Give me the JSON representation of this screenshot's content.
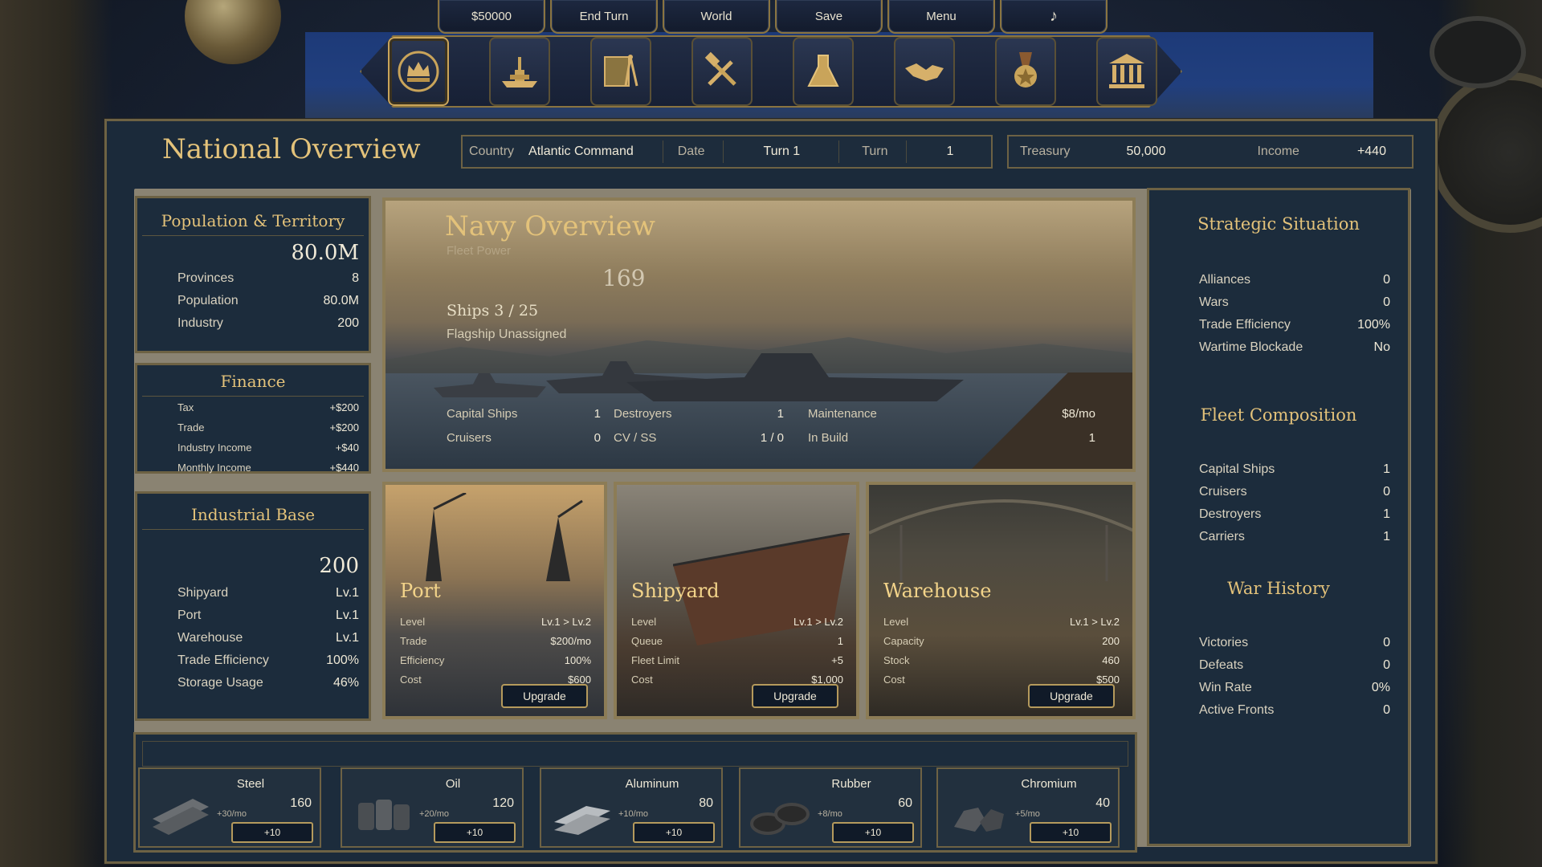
{
  "topbar": {
    "buttons": [
      "$50000",
      "End Turn",
      "World",
      "Save",
      "Menu",
      "♪"
    ]
  },
  "nav_icons": [
    "crown-icon",
    "battleship-icon",
    "map-compass-icon",
    "hammer-wrench-icon",
    "flask-icon",
    "handshake-icon",
    "medal-icon",
    "government-building-icon"
  ],
  "header": {
    "title": "National Overview",
    "country_label": "Country",
    "country": "Atlantic Command",
    "date_label": "Date",
    "date": "Turn 1",
    "turn_label": "Turn",
    "turn": "1",
    "treasury_label": "Treasury",
    "treasury": "50,000",
    "income_label": "Income",
    "income": "+440"
  },
  "population": {
    "title": "Population & Territory",
    "big": "80.0M",
    "rows": [
      {
        "label": "Provinces",
        "value": "8"
      },
      {
        "label": "Population",
        "value": "80.0M"
      },
      {
        "label": "Industry",
        "value": "200"
      }
    ]
  },
  "finance": {
    "title": "Finance",
    "rows": [
      {
        "label": "Tax",
        "value": "+$200"
      },
      {
        "label": "Trade",
        "value": "+$200"
      },
      {
        "label": "Industry Income",
        "value": "+$40"
      },
      {
        "label": "Monthly Income",
        "value": "+$440"
      }
    ]
  },
  "industrial": {
    "title": "Industrial Base",
    "big": "200",
    "rows": [
      {
        "label": "Shipyard",
        "value": "Lv.1"
      },
      {
        "label": "Port",
        "value": "Lv.1"
      },
      {
        "label": "Warehouse",
        "value": "Lv.1"
      },
      {
        "label": "Trade Efficiency",
        "value": "100%"
      },
      {
        "label": "Storage Usage",
        "value": "46%"
      }
    ]
  },
  "navy": {
    "title": "Navy Overview",
    "subtitle": "Fleet Power",
    "power": "169",
    "ships": "Ships 3 / 25",
    "flagship": "Flagship  Unassigned",
    "stats": [
      {
        "l1": "Capital Ships",
        "v1": "1",
        "l2": "Destroyers",
        "v2": "1",
        "l3": "Maintenance",
        "v3": "$8/mo"
      },
      {
        "l1": "Cruisers",
        "v1": "0",
        "l2": "CV / SS",
        "v2": "1 / 0",
        "l3": "In Build",
        "v3": "1"
      }
    ]
  },
  "buildings": [
    {
      "name": "Port",
      "rows": [
        {
          "label": "Level",
          "value": "Lv.1 > Lv.2"
        },
        {
          "label": "Trade",
          "value": "$200/mo"
        },
        {
          "label": "Efficiency",
          "value": "100%"
        },
        {
          "label": "Cost",
          "value": "$600"
        }
      ],
      "button": "Upgrade"
    },
    {
      "name": "Shipyard",
      "rows": [
        {
          "label": "Level",
          "value": "Lv.1 > Lv.2"
        },
        {
          "label": "Queue",
          "value": "1"
        },
        {
          "label": "Fleet Limit",
          "value": "+5"
        },
        {
          "label": "Cost",
          "value": "$1,000"
        }
      ],
      "button": "Upgrade"
    },
    {
      "name": "Warehouse",
      "rows": [
        {
          "label": "Level",
          "value": "Lv.1 > Lv.2"
        },
        {
          "label": "Capacity",
          "value": "200"
        },
        {
          "label": "Stock",
          "value": "460"
        },
        {
          "label": "Cost",
          "value": "$500"
        }
      ],
      "button": "Upgrade"
    }
  ],
  "resources": [
    {
      "name": "Steel",
      "amount": "160",
      "rate": "+30/mo",
      "button": "+10",
      "icon": "steel-beams-icon"
    },
    {
      "name": "Oil",
      "amount": "120",
      "rate": "+20/mo",
      "button": "+10",
      "icon": "oil-barrels-icon"
    },
    {
      "name": "Aluminum",
      "amount": "80",
      "rate": "+10/mo",
      "button": "+10",
      "icon": "aluminum-ingots-icon"
    },
    {
      "name": "Rubber",
      "amount": "60",
      "rate": "+8/mo",
      "button": "+10",
      "icon": "rubber-tires-icon"
    },
    {
      "name": "Chromium",
      "amount": "40",
      "rate": "+5/mo",
      "button": "+10",
      "icon": "chromium-ore-icon"
    }
  ],
  "strategic": {
    "title": "Strategic Situation",
    "rows": [
      {
        "label": "Alliances",
        "value": "0"
      },
      {
        "label": "Wars",
        "value": "0"
      },
      {
        "label": "Trade Efficiency",
        "value": "100%"
      },
      {
        "label": "Wartime Blockade",
        "value": "No"
      }
    ]
  },
  "fleet": {
    "title": "Fleet Composition",
    "rows": [
      {
        "label": "Capital Ships",
        "value": "1"
      },
      {
        "label": "Cruisers",
        "value": "0"
      },
      {
        "label": "Destroyers",
        "value": "1"
      },
      {
        "label": "Carriers",
        "value": "1"
      }
    ]
  },
  "war": {
    "title": "War History",
    "rows": [
      {
        "label": "Victories",
        "value": "0"
      },
      {
        "label": "Defeats",
        "value": "0"
      },
      {
        "label": "Win Rate",
        "value": "0%"
      },
      {
        "label": "Active Fronts",
        "value": "0"
      }
    ]
  },
  "colors": {
    "accent": "#e3c27a",
    "panel": "#1c2c3c",
    "border": "#6d6244"
  }
}
